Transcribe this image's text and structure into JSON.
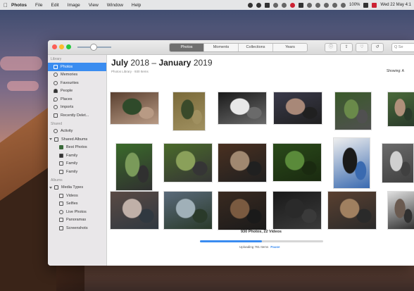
{
  "menubar": {
    "app_name": "Photos",
    "items": [
      "File",
      "Edit",
      "Image",
      "View",
      "Window",
      "Help"
    ],
    "status_text": "100%",
    "clock": "Wed 22 May 4:1"
  },
  "toolbar": {
    "tabs": [
      "Photos",
      "Moments",
      "Collections",
      "Years"
    ],
    "active_tab": "Photos",
    "search_placeholder": "Q Se"
  },
  "sidebar": {
    "library_header": "Library",
    "library_items": [
      "Photos",
      "Memories",
      "Favourites",
      "People",
      "Places",
      "Imports",
      "Recently Delet..."
    ],
    "shared_header": "Shared",
    "shared_items": [
      "Activity",
      "Shared Albums"
    ],
    "shared_album_items": [
      "Best Photos",
      "Family",
      "Family",
      "Family"
    ],
    "albums_header": "Albums",
    "albums_items": [
      "Media Types"
    ],
    "media_type_items": [
      "Videos",
      "Selfies",
      "Live Photos",
      "Panoramas",
      "Screenshots"
    ]
  },
  "main": {
    "title_month1": "July",
    "title_year1": "2018",
    "title_sep": "–",
    "title_month2": "January",
    "title_year2": "2019",
    "subtitle": "Photos Library · 930 Items",
    "showing": "Showing: A",
    "summary": "930 Photos, 22 Videos",
    "upload_status": "Uploading 781 Items",
    "pause_label": "Pause",
    "upload_progress": 0.5
  },
  "photos": [
    {
      "name": "family-on-sofa",
      "colors": [
        "#5a4030",
        "#2f4a2a",
        "#b89a84"
      ]
    },
    {
      "name": "man-in-garden",
      "colors": [
        "#7a6a3a",
        "#3a4a2a",
        "#a09060"
      ]
    },
    {
      "name": "black-white-cat",
      "colors": [
        "#1a1a1a",
        "#e8e8e8",
        "#6a6a6a"
      ]
    },
    {
      "name": "women-selfie",
      "colors": [
        "#3a3a4a",
        "#a88878",
        "#202020"
      ]
    },
    {
      "name": "couple-garden",
      "colors": [
        "#3a5a2a",
        "#6a8a4a",
        "#505050"
      ]
    },
    {
      "name": "baby-outdoors",
      "colors": [
        "#4a6a3a",
        "#b0907a",
        "#2a3a2a"
      ]
    },
    {
      "name": "family-garden-1",
      "colors": [
        "#3a6a2a",
        "#7a9a5a",
        "#303030"
      ]
    },
    {
      "name": "family-garden-2",
      "colors": [
        "#4a6a2a",
        "#8aa05a",
        "#353535"
      ]
    },
    {
      "name": "man-with-cat",
      "colors": [
        "#4a3020",
        "#a08870",
        "#202020"
      ]
    },
    {
      "name": "plant-closeup",
      "colors": [
        "#2a4a1a",
        "#5a8a3a",
        "#1a2a10"
      ]
    },
    {
      "name": "cat-portrait",
      "colors": [
        "#eeeeee",
        "#1a1a1a",
        "#3a6ab0"
      ]
    },
    {
      "name": "room-interior",
      "colors": [
        "#6a6a6a",
        "#d0d0d0",
        "#404040"
      ]
    },
    {
      "name": "child-on-couch",
      "colors": [
        "#5a4a44",
        "#c0b0a8",
        "#303840"
      ]
    },
    {
      "name": "rainbow-sky",
      "colors": [
        "#5a6a7a",
        "#a0b0b8",
        "#2a3a2a"
      ]
    },
    {
      "name": "dog-floor",
      "colors": [
        "#3a2a20",
        "#7a5a40",
        "#1a1a1a"
      ]
    },
    {
      "name": "dark-photo",
      "colors": [
        "#1a1a1a",
        "#2a2a2a",
        "#3a3a3a"
      ]
    },
    {
      "name": "floor-tiles",
      "colors": [
        "#5a4030",
        "#a08060",
        "#2a2a2a"
      ]
    },
    {
      "name": "older-man",
      "colors": [
        "#e0e0e0",
        "#6a5a50",
        "#303030"
      ]
    }
  ]
}
